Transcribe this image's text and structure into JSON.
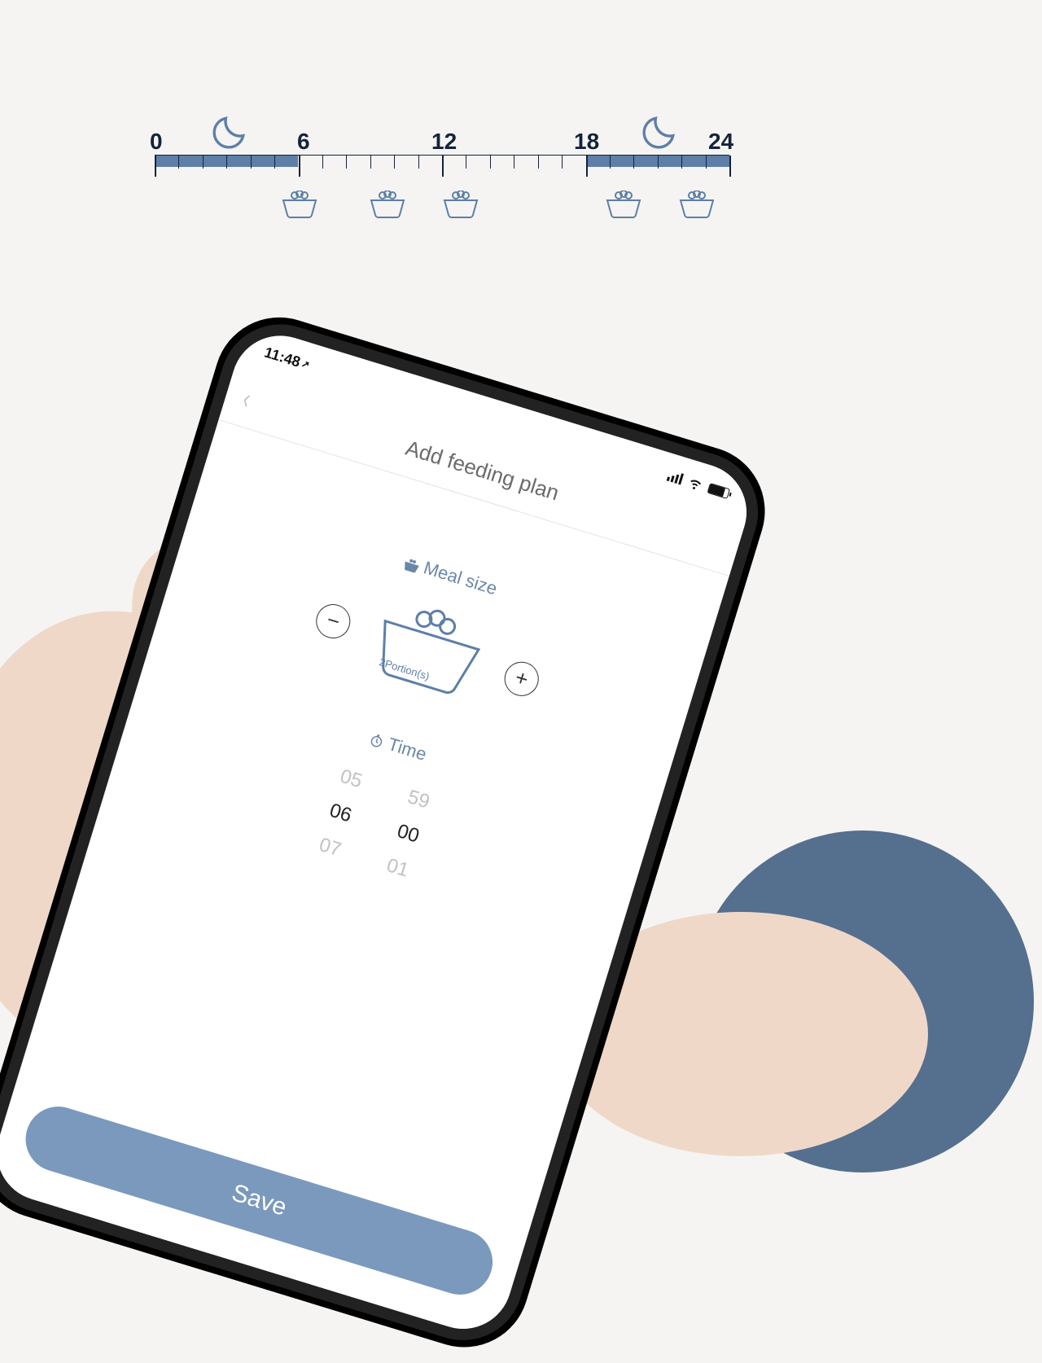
{
  "colors": {
    "accent": "#5d7fa8",
    "accent_light": "#7a99bd",
    "ink": "#14233b"
  },
  "timeline": {
    "labels": [
      "0",
      "6",
      "12",
      "18",
      "24"
    ],
    "night_bands": [
      {
        "from": 0,
        "to": 6
      },
      {
        "from": 18,
        "to": 24
      }
    ],
    "moon_positions": [
      3,
      21
    ],
    "bowl_positions": [
      6,
      9,
      12,
      18,
      21
    ]
  },
  "phone": {
    "status_time": "11:48",
    "nav_title": "Add feeding plan",
    "meal_section_label": "Meal size",
    "portion_text": "2Portion(s)",
    "minus": "−",
    "plus": "+",
    "time_section_label": "Time",
    "picker": {
      "hours": [
        "05",
        "06",
        "07"
      ],
      "minutes": [
        "59",
        "00",
        "01"
      ]
    },
    "save_label": "Save"
  }
}
